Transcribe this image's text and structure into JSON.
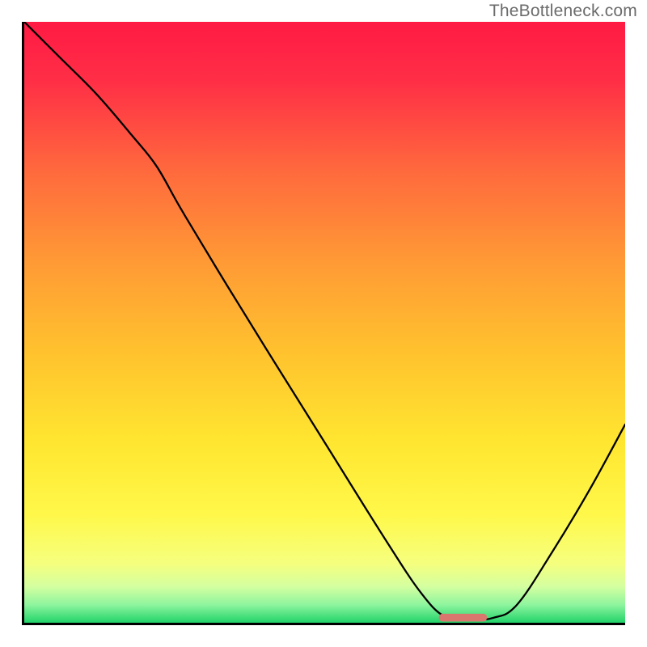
{
  "watermark": "TheBottleneck.com",
  "chart_data": {
    "type": "line",
    "title": "",
    "xlabel": "",
    "ylabel": "",
    "xlim": [
      0,
      100
    ],
    "ylim": [
      0,
      100
    ],
    "grid": false,
    "legend": false,
    "background": {
      "kind": "vertical-gradient",
      "stops": [
        {
          "offset": 0.0,
          "color": "#ff1a44"
        },
        {
          "offset": 0.1,
          "color": "#ff2f46"
        },
        {
          "offset": 0.25,
          "color": "#ff6a3d"
        },
        {
          "offset": 0.4,
          "color": "#ff9a35"
        },
        {
          "offset": 0.55,
          "color": "#ffc22e"
        },
        {
          "offset": 0.7,
          "color": "#ffe630"
        },
        {
          "offset": 0.82,
          "color": "#fff84a"
        },
        {
          "offset": 0.9,
          "color": "#f6ff7d"
        },
        {
          "offset": 0.94,
          "color": "#d4ffa0"
        },
        {
          "offset": 0.97,
          "color": "#8ef59e"
        },
        {
          "offset": 1.0,
          "color": "#22d36a"
        }
      ]
    },
    "series": [
      {
        "name": "bottleneck-curve",
        "x": [
          0,
          6,
          12,
          18,
          22,
          26,
          32,
          40,
          50,
          60,
          66,
          70,
          74,
          78,
          82,
          88,
          94,
          100
        ],
        "y": [
          100,
          94,
          88,
          81,
          76,
          69,
          59,
          46,
          30,
          14,
          5,
          1,
          0.5,
          0.8,
          3,
          12,
          22,
          33
        ]
      }
    ],
    "marker": {
      "name": "optimal-segment",
      "x_start": 69,
      "x_end": 77,
      "y": 0.5,
      "color": "#d9776e"
    }
  }
}
